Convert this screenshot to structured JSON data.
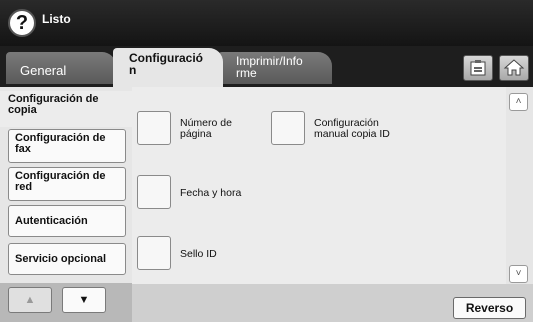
{
  "status": {
    "help_icon": "question-circle-icon",
    "help_glyph": "?",
    "text": "Listo"
  },
  "tabs": [
    {
      "label": "General",
      "active": false
    },
    {
      "label": "Configuració\nn",
      "active": true
    },
    {
      "label": "Imprimir/Info\nrme",
      "active": false
    }
  ],
  "top_icons": {
    "clipboard": "clipboard-icon",
    "home": "home-icon"
  },
  "sidebar": {
    "items": [
      {
        "label": "Configuración de copia",
        "selected": true
      },
      {
        "label": "Configuración de fax",
        "selected": false
      },
      {
        "label": "Configuración de red",
        "selected": false
      },
      {
        "label": "Autenticación",
        "selected": false
      },
      {
        "label": "Servicio opcional",
        "selected": false
      }
    ],
    "arrow_up": "▲",
    "arrow_down": "▼"
  },
  "options": [
    {
      "label": "Número de\npágina"
    },
    {
      "label": "Configuración\nmanual copia ID"
    },
    {
      "label": "Fecha y hora"
    },
    {
      "label": "Sello ID"
    }
  ],
  "scroll": {
    "up": "˄",
    "down": "˅"
  },
  "reverse_label": "Reverso",
  "colors": {
    "header": "#1e1e1e",
    "panel": "#e6e6e6",
    "button_border": "#8a8a8a"
  }
}
